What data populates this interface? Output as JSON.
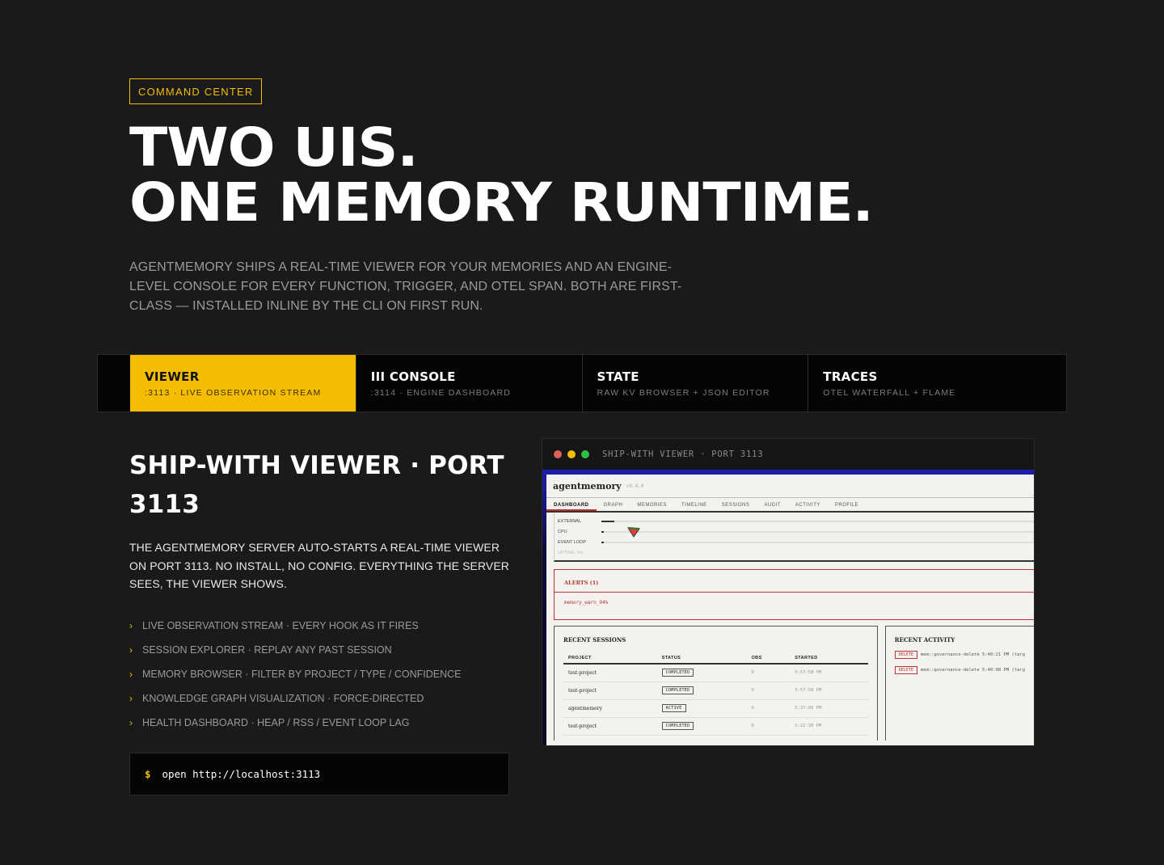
{
  "header": {
    "tag": "COMMAND CENTER",
    "title_line1": "TWO UIS.",
    "title_line2": "ONE MEMORY RUNTIME.",
    "lead": "AGENTMEMORY SHIPS A REAL-TIME VIEWER FOR YOUR MEMORIES AND AN ENGINE-LEVEL CONSOLE FOR EVERY FUNCTION, TRIGGER, AND OTEL SPAN. BOTH ARE FIRST-CLASS — INSTALLED INLINE BY THE CLI ON FIRST RUN."
  },
  "tabs": [
    {
      "title": "VIEWER",
      "sub": ":3113 · LIVE OBSERVATION STREAM",
      "active": true
    },
    {
      "title": "III CONSOLE",
      "sub": ":3114 · ENGINE DASHBOARD",
      "active": false
    },
    {
      "title": "STATE",
      "sub": "RAW KV BROWSER + JSON EDITOR",
      "active": false
    },
    {
      "title": "TRACES",
      "sub": "OTEL WATERFALL + FLAME",
      "active": false
    }
  ],
  "section": {
    "title": "SHIP-WITH VIEWER · PORT 3113",
    "description": "THE AGENTMEMORY SERVER AUTO-STARTS A REAL-TIME VIEWER ON PORT 3113. NO INSTALL, NO CONFIG. EVERYTHING THE SERVER SEES, THE VIEWER SHOWS.",
    "features": [
      "LIVE OBSERVATION STREAM · EVERY HOOK AS IT FIRES",
      "SESSION EXPLORER · REPLAY ANY PAST SESSION",
      "MEMORY BROWSER · FILTER BY PROJECT / TYPE / CONFIDENCE",
      "KNOWLEDGE GRAPH VISUALIZATION · FORCE-DIRECTED",
      "HEALTH DASHBOARD · HEAP / RSS / EVENT LOOP LAG"
    ],
    "command_prompt": "$",
    "command": "open http://localhost:3113"
  },
  "window": {
    "title": "SHIP-WITH VIEWER · PORT 3113",
    "dots": [
      "#e0605a",
      "#f5bd02",
      "#2cc140"
    ]
  },
  "app": {
    "logo": "agentmemory",
    "version": "v0.4.0",
    "nav": [
      "DASHBOARD",
      "GRAPH",
      "MEMORIES",
      "TIMELINE",
      "SESSIONS",
      "AUDIT",
      "ACTIVITY",
      "PROFILE"
    ],
    "metrics": [
      {
        "label": "EXTERNAL",
        "level": 0.03
      },
      {
        "label": "CPU",
        "level": 0.005
      },
      {
        "label": "EVENT LOOP",
        "level": 0.003
      }
    ],
    "uptime": "UPTIME: 0m",
    "alerts_title": "ALERTS (1)",
    "alert_message": "memory_warn_94%",
    "sessions_title": "RECENT SESSIONS",
    "sessions_columns": [
      "PROJECT",
      "STATUS",
      "OBS",
      "STARTED"
    ],
    "sessions": [
      {
        "project": "test-project",
        "status": "COMPLETED",
        "obs": "0",
        "started": "5:57:58 PM"
      },
      {
        "project": "test-project",
        "status": "COMPLETED",
        "obs": "0",
        "started": "5:57:58 PM"
      },
      {
        "project": "agentmemory",
        "status": "ACTIVE",
        "obs": "0",
        "started": "5:37:06 PM"
      },
      {
        "project": "test-project",
        "status": "COMPLETED",
        "obs": "0",
        "started": "5:22:30 PM"
      }
    ],
    "activity_title": "RECENT ACTIVITY",
    "activity": [
      {
        "action": "DELETE",
        "text": "mem::governance-delete 5:40:21 PM (targ"
      },
      {
        "action": "DELETE",
        "text": "mem::governance-delete 5:40:08 PM (targ"
      }
    ]
  },
  "colors": {
    "accent": "#f5bd02",
    "background": "#1a1a1a",
    "alert": "#b33333"
  }
}
